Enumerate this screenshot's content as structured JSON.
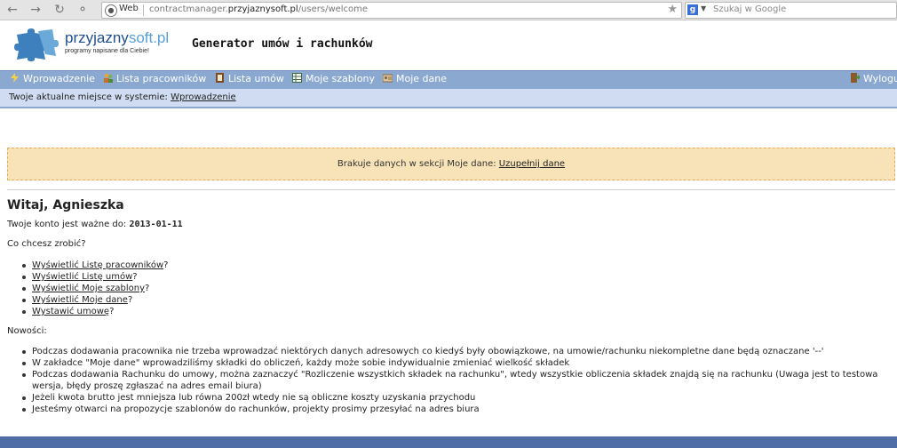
{
  "browser": {
    "web_label": "Web",
    "url_prefix": "contractmanager.",
    "url_domain": "przyjaznysoft.pl",
    "url_path": "/users/welcome",
    "search_placeholder": "Szukaj w Google"
  },
  "header": {
    "logo_name_part1": "przyjazny",
    "logo_name_part2": "soft.pl",
    "logo_tagline": "programy napisane dla Ciebie!",
    "app_title": "Generator umów i rachunków"
  },
  "menu": {
    "items": [
      {
        "label": "Wprowadzenie"
      },
      {
        "label": "Lista pracowników"
      },
      {
        "label": "Lista umów"
      },
      {
        "label": "Moje szablony"
      },
      {
        "label": "Moje dane"
      }
    ],
    "logout_label": "Wylogu"
  },
  "breadcrumb": {
    "prefix": "Twoje aktualne miejsce w systemie:",
    "current": "Wprowadzenie"
  },
  "warning": {
    "text": "Brakuje danych w sekcji Moje dane:",
    "link": "Uzupełnij dane"
  },
  "main": {
    "greeting": "Witaj, Agnieszka",
    "account_text": "Twoje konto jest ważne do:",
    "account_date": "2013-01-11",
    "question": "Co chcesz zrobić?",
    "actions": [
      {
        "link": "Wyświetlić Listę pracowników",
        "suffix": "?"
      },
      {
        "link": "Wyświetlić Listę umów",
        "suffix": "?"
      },
      {
        "link": "Wyświetlić Moje szablony",
        "suffix": "?"
      },
      {
        "link": "Wyświetlić Moje dane",
        "suffix": "?"
      },
      {
        "link": "Wystawić umowę",
        "suffix": "?"
      }
    ],
    "news_label": "Nowości:",
    "news": [
      "Podczas dodawania pracownika nie trzeba wprowadzać niektórych danych adresowych co kiedyś były obowiązkowe, na umowie/rachunku niekompletne dane będą oznaczane '--'",
      "W zakładce \"Moje dane\" wprowadziliśmy składki do obliczeń, każdy może sobie indywidualnie zmieniać wielkość składek",
      "Podczas dodawania Rachunku do umowy, można zaznaczyć \"Rozliczenie wszystkich składek na rachunku\", wtedy wszystkie obliczenia składek znajdą się na rachunku (Uwaga jest to testowa wersja, błędy proszę zgłaszać na adres email biura)",
      "Jeżeli kwota brutto jest mniejsza lub równa 200zł wtedy nie są obliczne koszty uzyskania przychodu",
      "Jesteśmy otwarci na propozycje szablonów do rachunków, projekty prosimy przesyłać na adres biura"
    ]
  },
  "colors": {
    "menu_bg": "#8aa8d0",
    "breadcrumb_bg": "#cfdcf1",
    "warning_bg": "#f8e3b8",
    "footer_bg": "#4f6ea8",
    "logo_blue": "#1f4f8f"
  }
}
